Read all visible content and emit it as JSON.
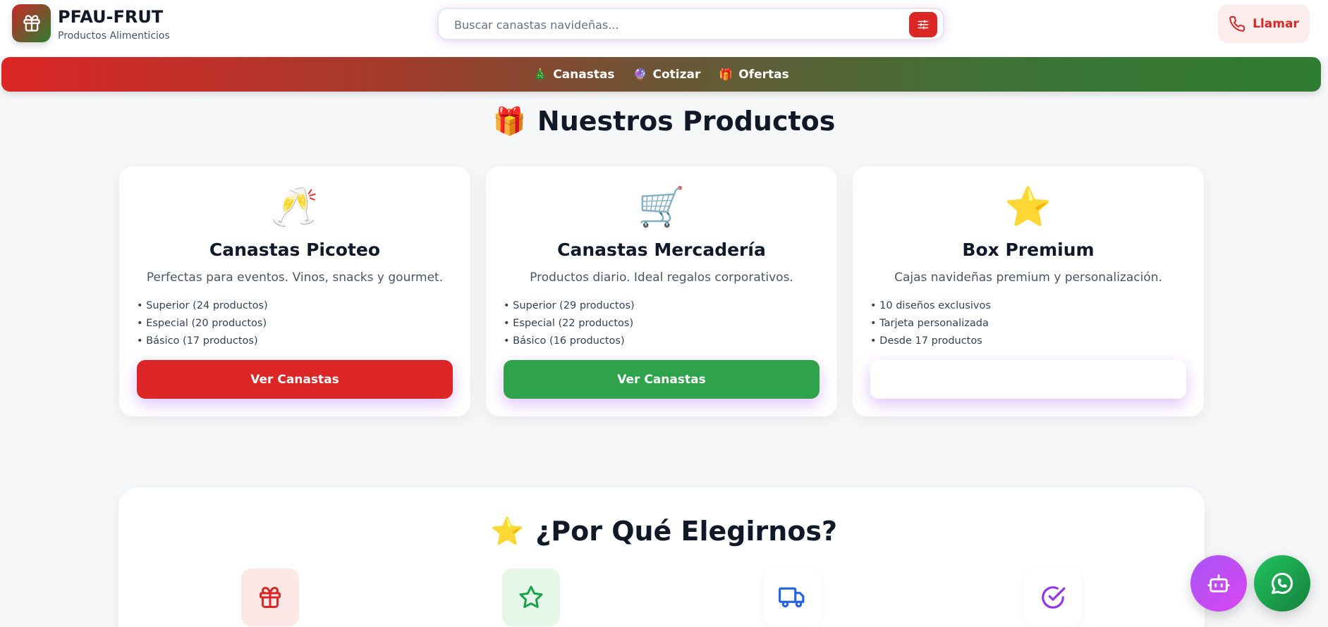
{
  "header": {
    "brand_name": "PFAU-FRUT",
    "brand_sub": "Productos Alimenticios",
    "logo_icon": "gift-icon",
    "search_placeholder": "Buscar canastas navideñas...",
    "filter_icon": "sliders-icon",
    "call_label": "Llamar",
    "call_icon": "phone-icon"
  },
  "nav": {
    "items": [
      {
        "emoji": "🎄",
        "label": "Canastas"
      },
      {
        "emoji": "🔮",
        "label": "Cotizar"
      },
      {
        "emoji": "🎁",
        "label": "Ofertas"
      }
    ]
  },
  "products": {
    "title_emoji": "🎁",
    "title": "Nuestros Productos",
    "cards": [
      {
        "icon": "🥂",
        "title": "Canastas Picoteo",
        "desc": "Perfectas para eventos. Vinos, snacks y gourmet.",
        "items": [
          "• Superior (24 productos)",
          "• Especial (20 productos)",
          "• Básico (17 productos)"
        ],
        "button": "Ver Canastas",
        "button_color": "#dc2626"
      },
      {
        "icon": "🛒",
        "title": "Canastas Mercadería",
        "desc": "Productos diario. Ideal regalos corporativos.",
        "items": [
          "• Superior (29 productos)",
          "• Especial (22 productos)",
          "• Básico (16 productos)"
        ],
        "button": "Ver Canastas",
        "button_color": "#2fa34c"
      },
      {
        "icon": "⭐",
        "title": "Box Premium",
        "desc": "Cajas navideñas premium y personalización.",
        "items": [
          "• 10 diseños exclusivos",
          "• Tarjeta personalizada",
          "• Desde 17 productos"
        ],
        "button": "",
        "button_color": "#ffffff"
      }
    ]
  },
  "why": {
    "title_emoji": "⭐",
    "title": "¿Por Qué Elegirnos?",
    "features": [
      {
        "icon": "gift-icon",
        "bg": "#fde8e8",
        "color": "#dc2626"
      },
      {
        "icon": "star-icon",
        "bg": "#e6f7ea",
        "color": "#16a34a"
      },
      {
        "icon": "truck-icon",
        "bg": "#ffffff",
        "color": "#2563eb"
      },
      {
        "icon": "check-circle-icon",
        "bg": "#ffffff",
        "color": "#9333ea"
      }
    ]
  },
  "fabs": {
    "bot_icon": "bot-icon",
    "whatsapp_icon": "whatsapp-icon"
  },
  "colors": {
    "brand_red": "#dc2626",
    "brand_green": "#2e7d32",
    "accent_purple": "#a855f7"
  }
}
